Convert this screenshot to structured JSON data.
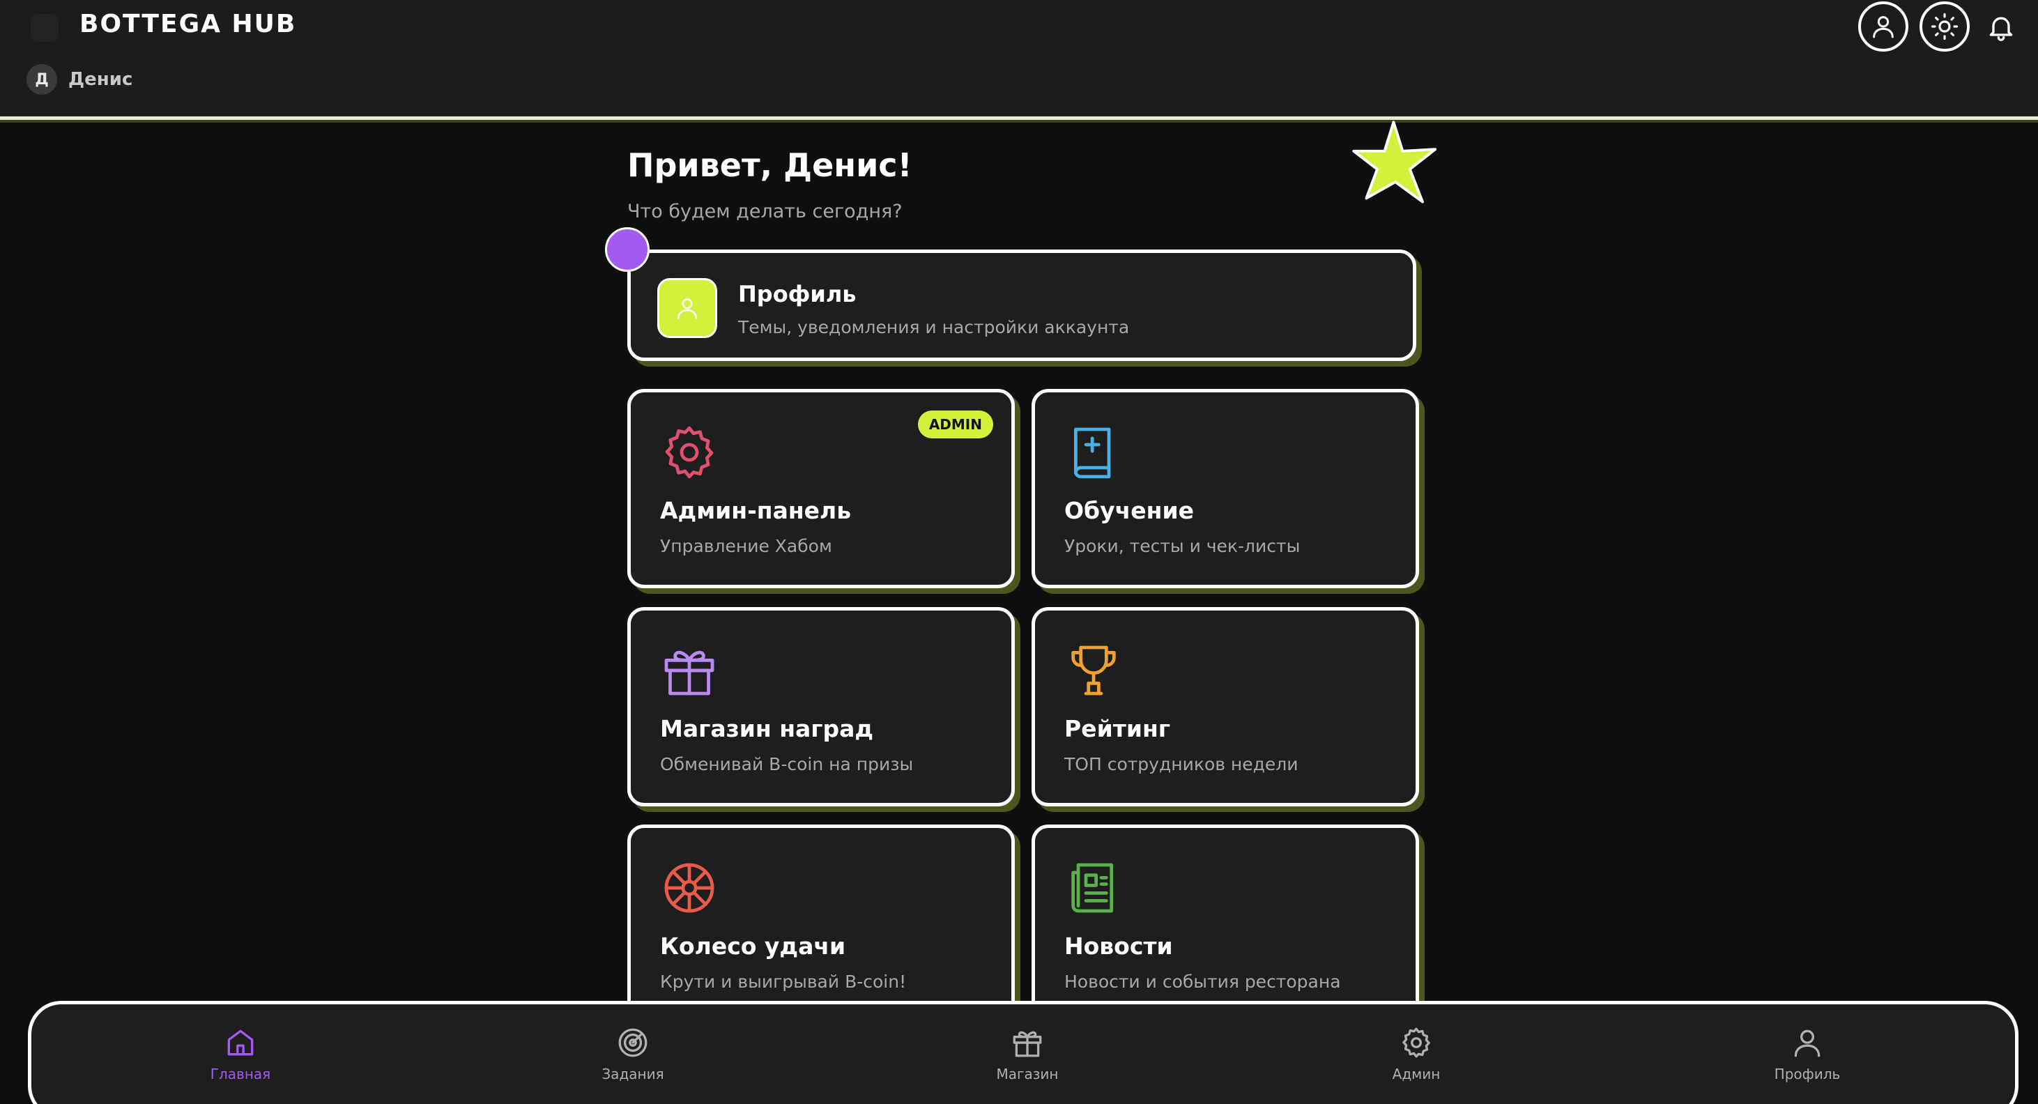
{
  "app": {
    "brand": "BOTTEGA HUB"
  },
  "user": {
    "initial": "Д",
    "name": "Денис"
  },
  "header": {
    "profile_icon": "user-icon",
    "theme_icon": "sun-icon",
    "notifications_icon": "bell-icon"
  },
  "main": {
    "greeting": "Привет, Денис!",
    "subtitle": "Что будем делать сегодня?",
    "profile_card": {
      "title": "Профиль",
      "description": "Темы, уведомления и настройки аккаунта",
      "icon": "user-icon"
    },
    "tiles": [
      {
        "title": "Админ-панель",
        "description": "Управление Хабом",
        "icon": "gear-icon",
        "badge": "ADMIN"
      },
      {
        "title": "Обучение",
        "description": "Уроки, тесты и чек-листы",
        "icon": "book-icon"
      },
      {
        "title": "Магазин наград",
        "description": "Обменивай B-coin на призы",
        "icon": "gift-icon"
      },
      {
        "title": "Рейтинг",
        "description": "ТОП сотрудников недели",
        "icon": "trophy-icon"
      },
      {
        "title": "Колесо удачи",
        "description": "Крути и выигрывай B-coin!",
        "icon": "wheel-icon"
      },
      {
        "title": "Новости",
        "description": "Новости и события ресторана",
        "icon": "newspaper-icon"
      }
    ]
  },
  "bottom_nav": [
    {
      "label": "Главная",
      "icon": "home-icon",
      "active": true
    },
    {
      "label": "Задания",
      "icon": "target-icon"
    },
    {
      "label": "Магазин",
      "icon": "gift-icon"
    },
    {
      "label": "Админ",
      "icon": "gear-icon"
    },
    {
      "label": "Профиль",
      "icon": "user-icon"
    }
  ],
  "colors": {
    "accent_lime": "#d4f03a",
    "accent_purple": "#a35af0",
    "admin_icon": "#e0506a",
    "learning_icon": "#4ab0e8",
    "shop_icon": "#b98af0",
    "rating_icon": "#f0a030",
    "wheel_icon": "#e85a4a",
    "news_icon": "#5ab04a"
  }
}
